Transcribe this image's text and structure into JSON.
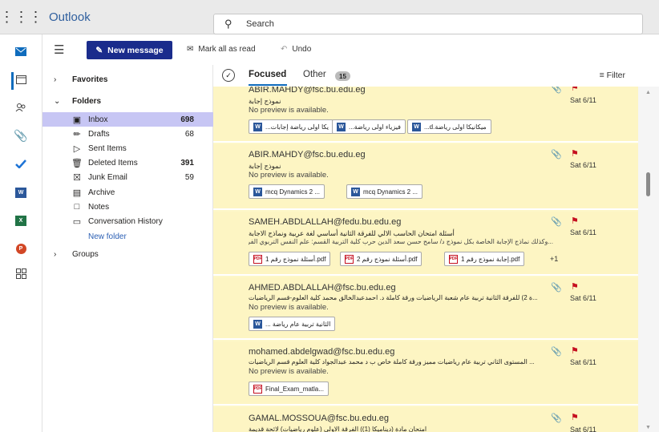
{
  "app": {
    "name": "Outlook"
  },
  "search": {
    "placeholder": "Search"
  },
  "toolbar": {
    "new_message": "New message",
    "mark_all_read": "Mark all as read",
    "undo": "Undo"
  },
  "folders": {
    "favorites": "Favorites",
    "folders": "Folders",
    "items": [
      {
        "label": "Inbox",
        "count": "698",
        "icon": "inbox-icon"
      },
      {
        "label": "Drafts",
        "count": "68",
        "icon": "pencil-icon"
      },
      {
        "label": "Sent Items",
        "count": "",
        "icon": "send-icon"
      },
      {
        "label": "Deleted Items",
        "count": "391",
        "icon": "trash-icon"
      },
      {
        "label": "Junk Email",
        "count": "59",
        "icon": "junk-icon"
      },
      {
        "label": "Archive",
        "count": "",
        "icon": "archive-icon"
      },
      {
        "label": "Notes",
        "count": "",
        "icon": "note-icon"
      },
      {
        "label": "Conversation History",
        "count": "",
        "icon": "folder-icon"
      }
    ],
    "new_folder": "New folder",
    "groups": "Groups"
  },
  "tabs": {
    "focused": "Focused",
    "other": "Other",
    "other_count": "15",
    "filter": "Filter"
  },
  "messages": [
    {
      "from": "ABIR.MAHDY@fsc.bu.edu.eg",
      "subject": "نموذج إجابة",
      "preview": "No preview is available.",
      "date": "Sat 6/11",
      "attachments": [
        "...يكا اولى رياضة إجابات",
        "...فيزياء اولى رياضة",
        "...d.ميكانيكا اولى رياضة"
      ]
    },
    {
      "from": "ABIR.MAHDY@fsc.bu.edu.eg",
      "subject": "نموذج إجابة",
      "preview": "No preview is available.",
      "date": "Sat 6/11",
      "attachments": [
        "mcq Dynamics 2 ...",
        "mcq Dynamics 2 ..."
      ]
    },
    {
      "from": "SAMEH.ABDLALLAH@fedu.bu.edu.eg",
      "subject": "أسئلة امتحان الحاسب الالي للفرقة الثانية أساسي لغة عربية ونماذج الاجابة",
      "preview": "...وكذلك نماذج الإجابة الخاصة بكل نموذج د/ سامح حسن سعد الدين حرب كلية التربية القسم: علم النفس التربوي الفرقة: الثان",
      "date": "Sat 6/11",
      "attachments": [
        "إجابة نموذج رقم 1.pdf",
        "أسئلة نموذج رقم 2.pdf",
        "أسئلة نموذج رقم 1.pdf"
      ],
      "more": "+1"
    },
    {
      "from": "AHMED.ABDLALLAH@fsc.bu.edu.eg",
      "subject": "...ة 2) للفرقة الثانية تربية عام شعبة الرياضيات ورقة كاملة د. احمدعبدالخالق محمد كلية العلوم-قسم الرياضيات",
      "preview": "No preview is available.",
      "date": "Sat 6/11",
      "attachments": [
        "... الثانية تربية عام رياضة"
      ]
    },
    {
      "from": "mohamed.abdelgwad@fsc.bu.edu.eg",
      "subject": "... المستوى الثاني تربية عام رياضيات مميز ورقة كاملة خاص ب د محمد عبدالجواد كلية العلوم قسم الرياضيات",
      "preview": "No preview is available.",
      "date": "Sat 6/11",
      "attachments": [
        "Final_Exam_matla..."
      ]
    },
    {
      "from": "GAMAL.MOSSOUA@fsc.bu.edu.eg",
      "subject": "امتحان مادة (ديناميكا (1)) الفرقة الاولى (علوم رياضيات) لائحة قديمة",
      "preview": "",
      "date": "Sat 6/11",
      "attachments": []
    }
  ],
  "icons": {
    "mail": "mail-icon",
    "calendar": "calendar-icon",
    "people": "people-icon",
    "attach": "paperclip-icon",
    "todo": "todo-icon",
    "word": "word-icon",
    "excel": "excel-icon",
    "powerpoint": "powerpoint-icon",
    "apps": "apps-icon"
  },
  "colors": {
    "accent": "#0f6cbd",
    "new_message_bg": "#1a2c8c",
    "selected_folder": "#c7c6f4",
    "unread_bg": "#fdf5c3",
    "flag": "#c50f1f"
  }
}
